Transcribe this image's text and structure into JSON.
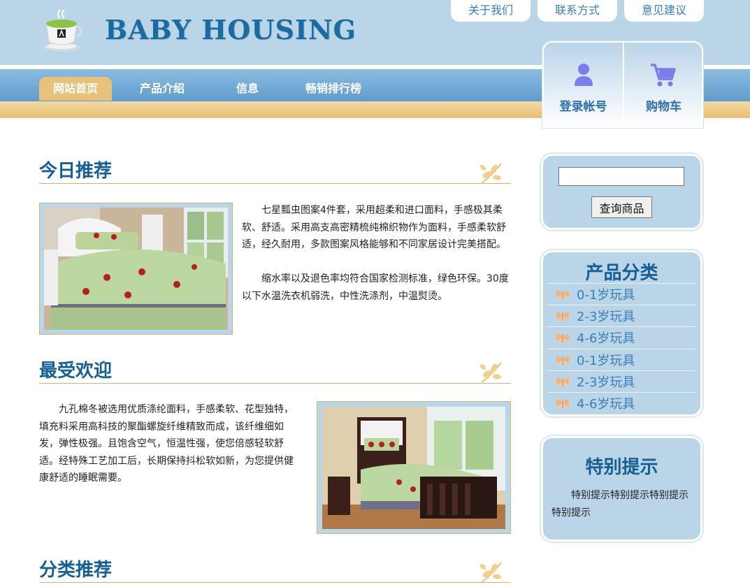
{
  "header": {
    "logo_text": "BABY HOUSING",
    "top_links": [
      "关于我们",
      "联系方式",
      "意见建议"
    ],
    "nav": [
      "网站首页",
      "产品介绍",
      "信息",
      "畅销排行榜"
    ],
    "account": {
      "login_label": "登录帐号",
      "cart_label": "购物车"
    }
  },
  "sections": {
    "today": {
      "title": "今日推荐",
      "paragraphs": [
        "七星瓢虫图案4件套，采用超柔和进口面料，手感极其柔软、舒适。采用高支高密精梳纯棉织物作为面料，手感柔软舒适，经久耐用，多款图案风格能够和不同家居设计完美搭配。",
        "缩水率以及退色率均符合国家检测标准，绿色环保。30度以下水温洗衣机弱洗，中性洗涤剂，中温熨烫。"
      ]
    },
    "popular": {
      "title": "最受欢迎",
      "paragraph": "九孔棉冬被选用优质涤纶面料，手感柔软、花型独特，填充料采用高科技的聚酯螺旋纤维精致而成，该纤维细如发，弹性极强。且饱含空气，恒温性强，使您倍感轻软舒适。经特殊工艺加工后，长期保持抖松软如新，为您提供健康舒适的睡眠需要。"
    },
    "category": {
      "title": "分类推荐"
    }
  },
  "sidebar": {
    "search": {
      "value": "",
      "placeholder": "",
      "button_label": "查询商品"
    },
    "categories": {
      "title": "产品分类",
      "items": [
        "0-1岁玩具",
        "2-3岁玩具",
        "4-6岁玩具",
        "0-1岁玩具",
        "2-3岁玩具",
        "4-6岁玩具"
      ]
    },
    "tips": {
      "title": "特别提示",
      "text": "特别提示特别提示特别提示特别提示"
    }
  }
}
